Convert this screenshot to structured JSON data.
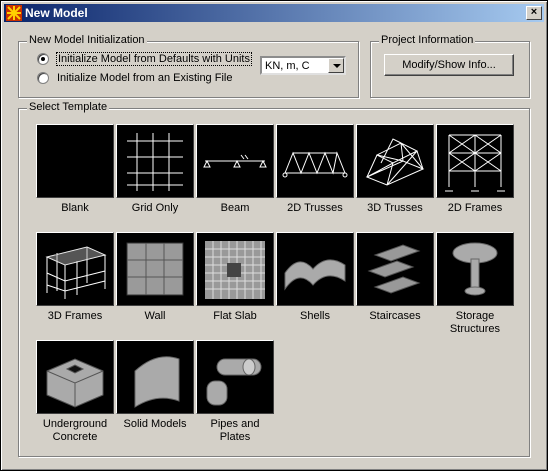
{
  "window": {
    "title": "New Model",
    "close_glyph": "×"
  },
  "init": {
    "legend": "New Model Initialization",
    "option_defaults": "Initialize Model from Defaults with Units",
    "option_existing": "Initialize Model  from an Existing File",
    "selected_option": "defaults",
    "units": "KN, m, C"
  },
  "project": {
    "legend": "Project Information",
    "button": "Modify/Show Info..."
  },
  "templates": {
    "legend": "Select Template",
    "items": [
      {
        "label": "Blank",
        "icon": "blank-template-icon"
      },
      {
        "label": "Grid Only",
        "icon": "grid-only-template-icon"
      },
      {
        "label": "Beam",
        "icon": "beam-template-icon"
      },
      {
        "label": "2D Trusses",
        "icon": "2d-truss-template-icon"
      },
      {
        "label": "3D Trusses",
        "icon": "3d-truss-template-icon"
      },
      {
        "label": "2D Frames",
        "icon": "2d-frame-template-icon"
      },
      {
        "label": "3D Frames",
        "icon": "3d-frame-template-icon"
      },
      {
        "label": "Wall",
        "icon": "wall-template-icon"
      },
      {
        "label": "Flat Slab",
        "icon": "flat-slab-template-icon"
      },
      {
        "label": "Shells",
        "icon": "shells-template-icon"
      },
      {
        "label": "Staircases",
        "icon": "staircase-template-icon"
      },
      {
        "label": "Storage\nStructures",
        "icon": "storage-structure-template-icon"
      },
      {
        "label": "Underground\nConcrete",
        "icon": "underground-concrete-template-icon"
      },
      {
        "label": "Solid Models",
        "icon": "solid-model-template-icon"
      },
      {
        "label": "Pipes and\nPlates",
        "icon": "pipes-plates-template-icon"
      }
    ]
  }
}
